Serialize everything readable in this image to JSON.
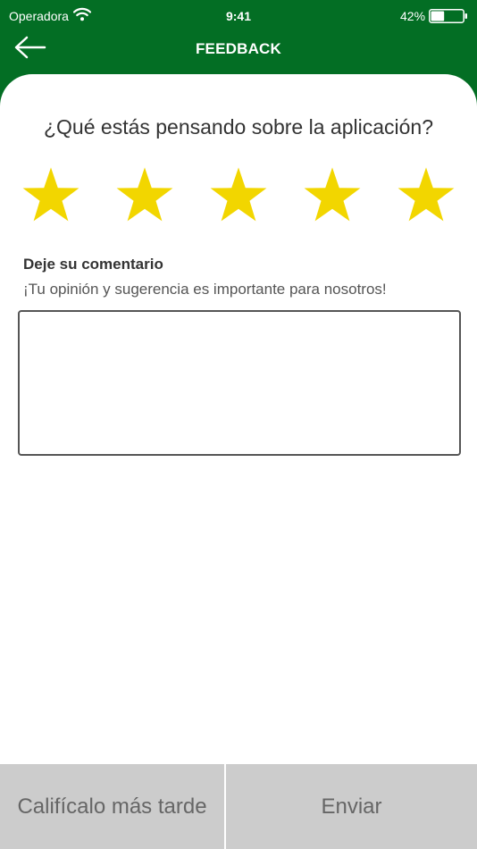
{
  "status_bar": {
    "carrier": "Operadora",
    "time": "9:41",
    "battery": "42%",
    "battery_level": 0.42
  },
  "header": {
    "title": "FEEDBACK",
    "back_icon": "arrow-left-icon"
  },
  "rating": {
    "question": "¿Qué estás pensando sobre la aplicación?",
    "stars_filled": 5,
    "stars_total": 5,
    "star_color": "#f2d600"
  },
  "comment": {
    "label": "Deje su comentario",
    "hint": "¡Tu opinión y sugerencia es importante para nosotros!",
    "value": "",
    "placeholder": ""
  },
  "footer": {
    "later_label": "Califícalo más tarde",
    "send_label": "Enviar"
  },
  "colors": {
    "header_bg": "#036e24",
    "footer_bg": "#cccccc",
    "button_text": "#666666"
  }
}
